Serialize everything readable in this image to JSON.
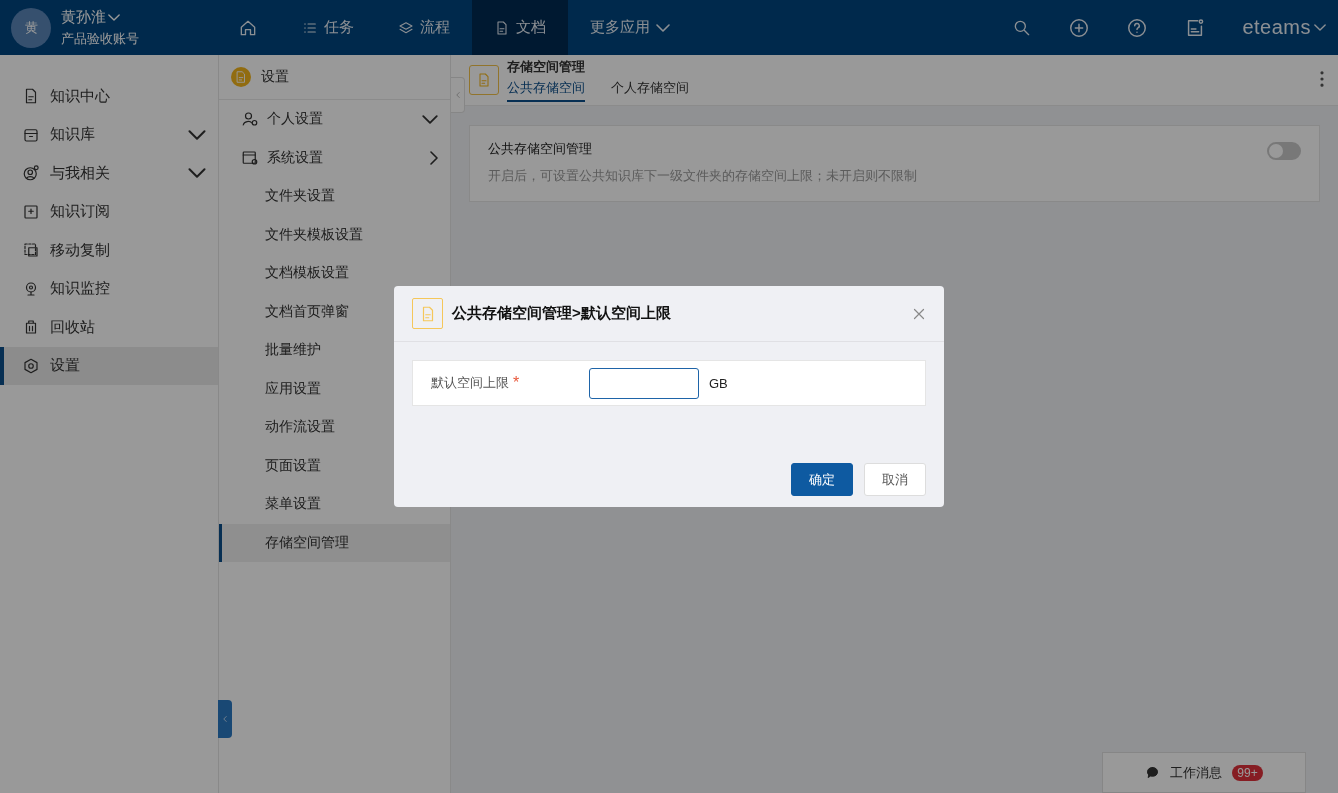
{
  "user": {
    "avatar": "黄",
    "name": "黄孙淮",
    "account": "产品验收账号"
  },
  "nav": [
    {
      "kind": "home",
      "selected": false
    },
    {
      "kind": "list",
      "label": "任务",
      "selected": false
    },
    {
      "kind": "layers",
      "label": "流程",
      "selected": false
    },
    {
      "kind": "doc",
      "label": "文档",
      "selected": true
    },
    {
      "kind": "more",
      "label": "更多应用",
      "selected": false
    }
  ],
  "brand": "eteams",
  "sidebar": {
    "items": [
      {
        "kind": "doc",
        "label": "知识中心",
        "expandable": false,
        "selected": false
      },
      {
        "kind": "box",
        "label": "知识库",
        "expandable": true,
        "selected": false
      },
      {
        "kind": "user",
        "label": "与我相关",
        "expandable": true,
        "selected": false
      },
      {
        "kind": "plus",
        "label": "知识订阅",
        "expandable": false,
        "selected": false
      },
      {
        "kind": "copy",
        "label": "移动复制",
        "expandable": false,
        "selected": false
      },
      {
        "kind": "cam",
        "label": "知识监控",
        "expandable": false,
        "selected": false
      },
      {
        "kind": "trash",
        "label": "回收站",
        "expandable": false,
        "selected": false
      },
      {
        "kind": "gear",
        "label": "设置",
        "expandable": false,
        "selected": true
      }
    ]
  },
  "submenu": {
    "title": "设置",
    "groups": [
      {
        "kind": "person",
        "label": "个人设置",
        "expanded": false
      },
      {
        "kind": "system",
        "label": "系统设置",
        "expanded": true,
        "children": [
          {
            "label": "文件夹设置",
            "selected": false
          },
          {
            "label": "文件夹模板设置",
            "selected": false
          },
          {
            "label": "文档模板设置",
            "selected": false
          },
          {
            "label": "文档首页弹窗",
            "selected": false
          },
          {
            "label": "批量维护",
            "selected": false
          },
          {
            "label": "应用设置",
            "selected": false
          },
          {
            "label": "动作流设置",
            "selected": false
          },
          {
            "label": "页面设置",
            "selected": false
          },
          {
            "label": "菜单设置",
            "selected": false
          },
          {
            "label": "存储空间管理",
            "selected": true
          }
        ]
      }
    ]
  },
  "page": {
    "title": "存储空间管理",
    "tabs": [
      {
        "label": "公共存储空间",
        "selected": true
      },
      {
        "label": "个人存储空间",
        "selected": false
      }
    ],
    "setting": {
      "title": "公共存储空间管理",
      "description": "开启后，可设置公共知识库下一级文件夹的存储空间上限；未开启则不限制",
      "on": false
    }
  },
  "dialog": {
    "title": "公共存储空间管理>默认空间上限",
    "field": {
      "label": "默认空间上限",
      "required_mark": "*",
      "unit": "GB"
    },
    "buttons": [
      {
        "kind": "primary",
        "label": "确定"
      },
      {
        "kind": "default",
        "label": "取消"
      }
    ]
  },
  "messages": {
    "label": "工作消息",
    "badge": "99+"
  }
}
